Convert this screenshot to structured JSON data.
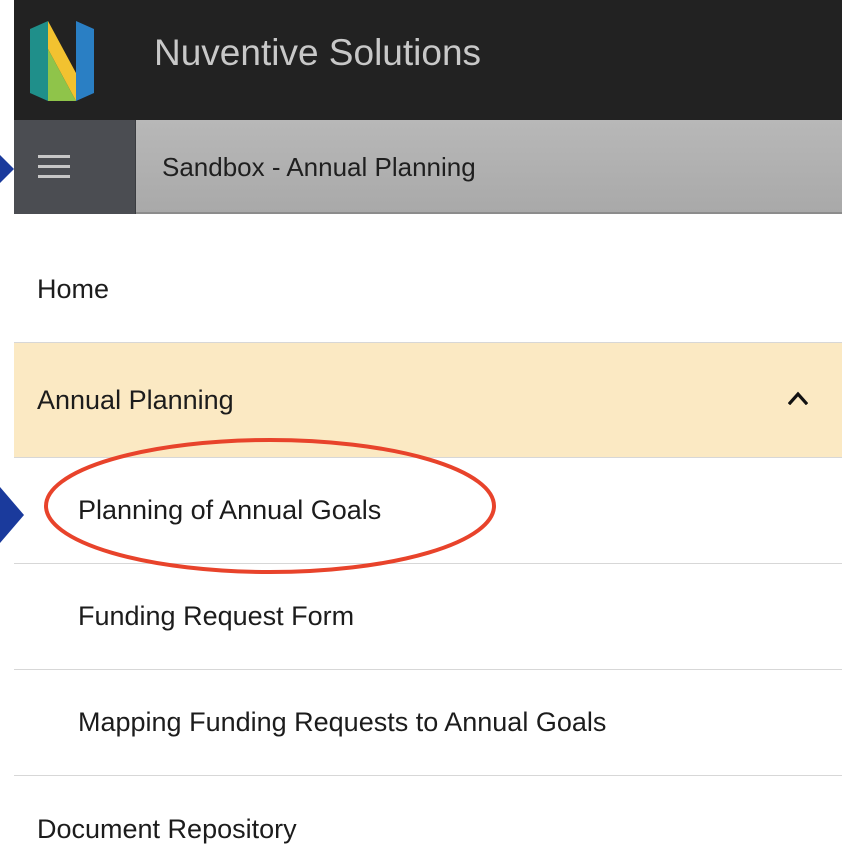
{
  "header": {
    "app_title": "Nuventive Solutions",
    "logo": "nuventive-n-logo",
    "bar_color": "#222222"
  },
  "subheader": {
    "menu_icon": "hamburger-menu-icon",
    "workspace_title": "Sandbox - Annual Planning"
  },
  "nav": {
    "home": "Home",
    "annual_planning": {
      "label": "Annual Planning",
      "expanded": true,
      "icon": "chevron-up-icon",
      "highlight_color": "#fbe9c3",
      "children": [
        "Planning of Annual Goals",
        "Funding Request Form",
        "Mapping Funding Requests to Annual Goals"
      ]
    },
    "document_repository": "Document Repository"
  },
  "annotations": {
    "ellipse_color": "#e8432b",
    "arrow_color": "#1a3a9c"
  }
}
